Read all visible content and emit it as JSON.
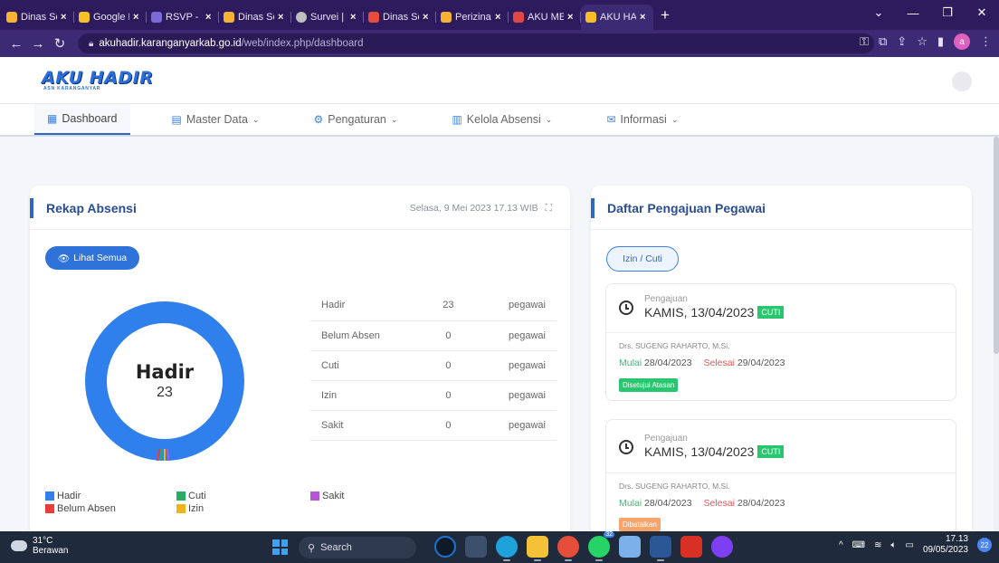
{
  "browser": {
    "tabs": [
      {
        "label": "Dinas Sosi",
        "color": "#f5b335"
      },
      {
        "label": "Google Ke",
        "color": "#f6c026"
      },
      {
        "label": "RSVP - Go",
        "color": "#7c6bd6"
      },
      {
        "label": "Dinas Sosi",
        "color": "#f5b335"
      },
      {
        "label": "Survei | SK",
        "color": "#bfbfbf"
      },
      {
        "label": "Dinas Sosi",
        "color": "#e84b3c"
      },
      {
        "label": "Perizinan",
        "color": "#f5b335"
      },
      {
        "label": "AKU MELA",
        "color": "#e04848"
      },
      {
        "label": "AKU HADI",
        "color": "#f6c026"
      }
    ],
    "new_tab": "+",
    "url_host": "akuhadir.karanganyarkab.go.id",
    "url_path": "/web/index.php/dashboard",
    "profile_initial": "a"
  },
  "app": {
    "logo_main": "AKU HADIR",
    "logo_sub": "ASN KARANGANYAR"
  },
  "menu": [
    {
      "label": "Dashboard",
      "icon": "▦",
      "dropdown": false
    },
    {
      "label": "Master Data",
      "icon": "▤",
      "dropdown": true
    },
    {
      "label": "Pengaturan",
      "icon": "⚙",
      "dropdown": true
    },
    {
      "label": "Kelola Absensi",
      "icon": "▥",
      "dropdown": true
    },
    {
      "label": "Informasi",
      "icon": "✉",
      "dropdown": true
    }
  ],
  "rekap": {
    "title": "Rekap Absensi",
    "datetime": "Selasa, 9 Mei 2023 17.13 WIB",
    "lihat_label": "Lihat Semua",
    "center_label": "Hadir",
    "center_value": "23",
    "unit": "pegawai",
    "rows": [
      {
        "label": "Hadir",
        "value": "23"
      },
      {
        "label": "Belum Absen",
        "value": "0"
      },
      {
        "label": "Cuti",
        "value": "0"
      },
      {
        "label": "Izin",
        "value": "0"
      },
      {
        "label": "Sakit",
        "value": "0"
      }
    ],
    "legend": [
      {
        "label": "Hadir",
        "color": "#2f80ed"
      },
      {
        "label": "Cuti",
        "color": "#27ae60"
      },
      {
        "label": "Sakit",
        "color": "#b655d6"
      },
      {
        "label": "Belum Absen",
        "color": "#eb3b3b"
      },
      {
        "label": "Izin",
        "color": "#f2b21a"
      }
    ],
    "donut_colors": {
      "hadir": "#2f80ed",
      "belum": "#eb3b3b",
      "cuti": "#27ae60",
      "izin": "#f2b21a",
      "sakit": "#b655d6"
    }
  },
  "pengajuan": {
    "title": "Daftar Pengajuan Pegawai",
    "tab_label": "Izin / Cuti",
    "items": [
      {
        "label": "Pengajuan",
        "date": "KAMIS, 13/04/2023",
        "badge": "CUTI",
        "name": "Drs. SUGENG RAHARTO, M.Si.",
        "mulai_label": "Mulai",
        "mulai": "28/04/2023",
        "selesai_label": "Selesai",
        "selesai": "29/04/2023",
        "status": "Disetujui Atasan"
      },
      {
        "label": "Pengajuan",
        "date": "KAMIS, 13/04/2023",
        "badge": "CUTI",
        "name": "Drs. SUGENG RAHARTO, M.Si.",
        "mulai_label": "Mulai",
        "mulai": "28/04/2023",
        "selesai_label": "Selesai",
        "selesai": "28/04/2023",
        "status": "Dibatalkan"
      }
    ]
  },
  "taskbar": {
    "temp": "31°C",
    "weather": "Berawan",
    "search": "Search",
    "time": "17.13",
    "date": "09/05/2023",
    "notif_count": "22",
    "badge_count": "32"
  }
}
